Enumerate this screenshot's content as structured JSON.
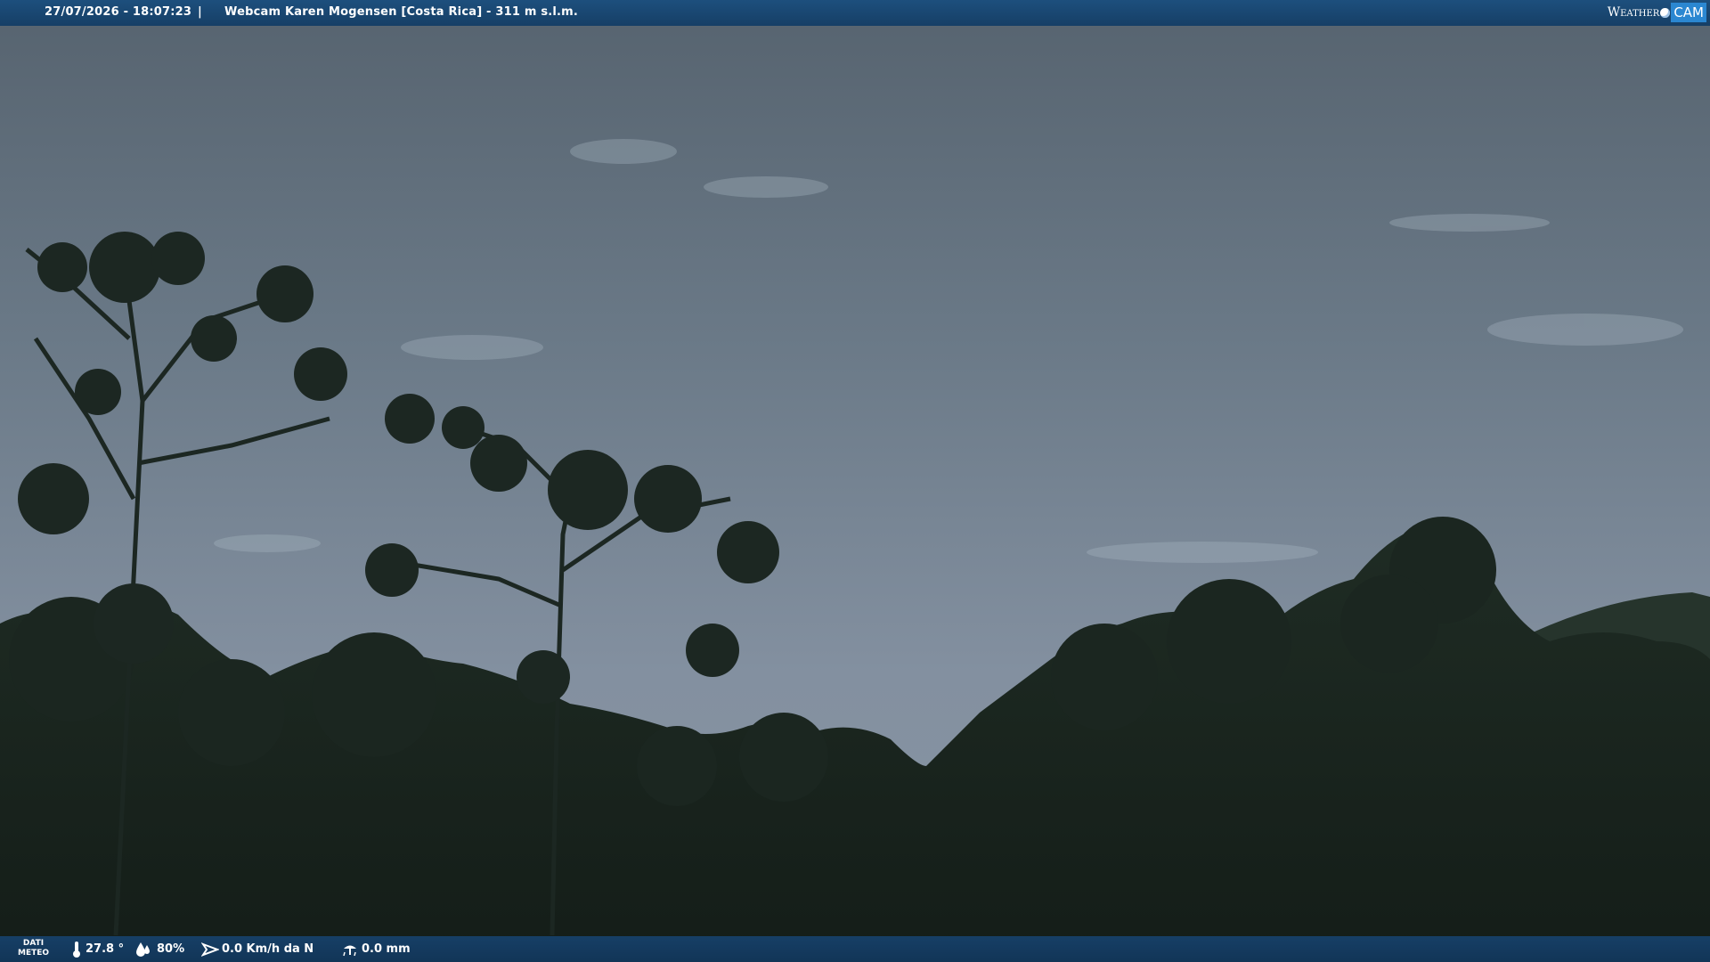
{
  "header": {
    "datetime": "27/07/2026 - 18:07:23",
    "separator": "|",
    "title": "Webcam Karen Mogensen [Costa Rica]  - 311 m s.l.m."
  },
  "logo": {
    "weather": "Weather",
    "cam": "CAM"
  },
  "footer": {
    "dati_line1": "DATI",
    "dati_line2": "METEO",
    "temperature": "27.8 °",
    "humidity": "80%",
    "wind": "0.0 Km/h da N",
    "rain": "0.0 mm"
  },
  "icons": [
    "thermometer-icon",
    "humidity-drop-icon",
    "wind-icon",
    "rain-icon"
  ],
  "colors": {
    "bar": "#163f66",
    "logo_accent": "#2b87d1"
  }
}
